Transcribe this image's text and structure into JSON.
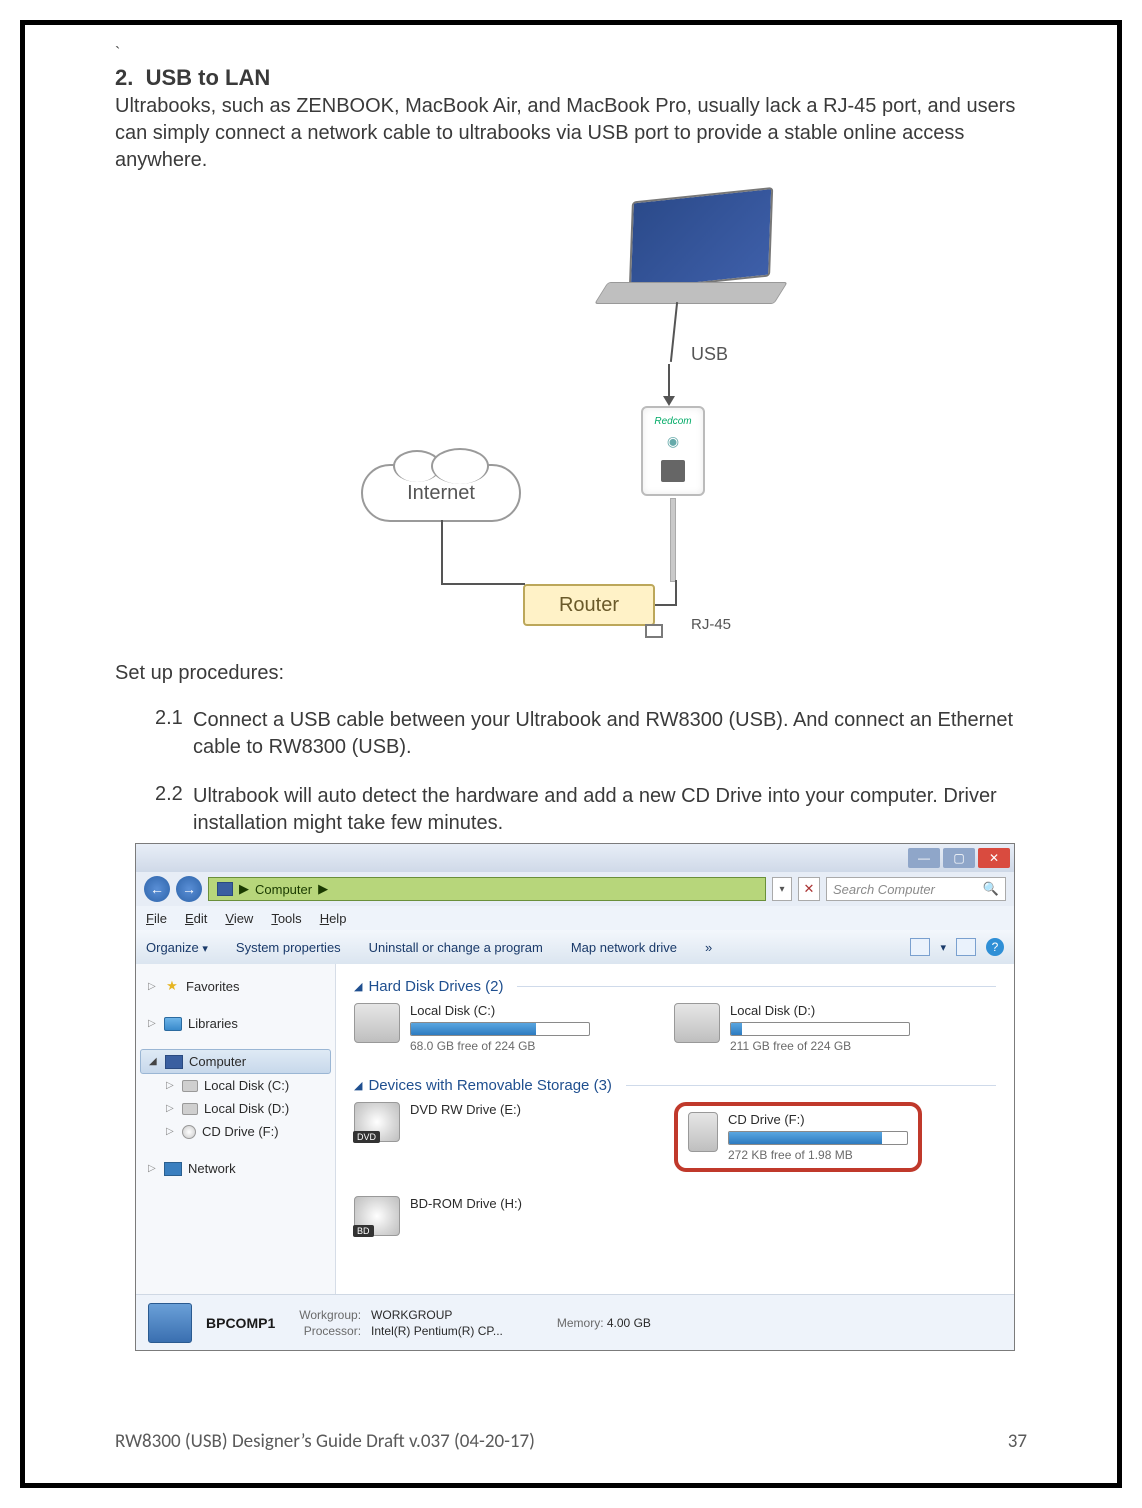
{
  "backtick": "`",
  "heading_num": "2.",
  "heading_title": "USB to LAN",
  "intro": "Ultrabooks, such as ZENBOOK, MacBook Air, and MacBook Pro, usually lack a RJ-45 port, and users can simply connect a network cable to ultrabooks via USB port to provide a stable online access anywhere.",
  "diagram": {
    "internet": "Internet",
    "router": "Router",
    "usb": "USB",
    "rj45": "RJ-45",
    "brand": "Redcom"
  },
  "setup_label": "Set up procedures:",
  "steps": [
    {
      "num": "2.1",
      "text": "Connect a USB cable between your Ultrabook and RW8300 (USB). And connect an Ethernet cable to RW8300 (USB)."
    },
    {
      "num": "2.2",
      "text": "Ultrabook will auto detect the hardware and add a new CD Drive into your computer. Driver installation might take few minutes."
    }
  ],
  "explorer": {
    "breadcrumb_label": "Computer",
    "breadcrumb_arrow": "▶",
    "search_placeholder": "Search Computer",
    "menus": {
      "file": "File",
      "edit": "Edit",
      "view": "View",
      "tools": "Tools",
      "help": "Help"
    },
    "toolbar": {
      "organize": "Organize",
      "sysprops": "System properties",
      "uninstall": "Uninstall or change a program",
      "mapdrive": "Map network drive",
      "more": "»"
    },
    "sidebar": {
      "favorites": "Favorites",
      "libraries": "Libraries",
      "computer": "Computer",
      "local_c": "Local Disk (C:)",
      "local_d": "Local Disk (D:)",
      "cd_f": "CD Drive (F:)",
      "network": "Network"
    },
    "groups": {
      "hdd": "Hard Disk Drives (2)",
      "removable": "Devices with Removable Storage (3)"
    },
    "drives": {
      "c": {
        "name": "Local Disk (C:)",
        "free": "68.0 GB free of 224 GB",
        "fill": 70
      },
      "d": {
        "name": "Local Disk (D:)",
        "free": "211 GB free of 224 GB",
        "fill": 6
      },
      "dvd": {
        "name": "DVD RW Drive (E:)",
        "badge": "DVD"
      },
      "cdf": {
        "name": "CD Drive (F:)",
        "free": "272 KB free of 1.98 MB",
        "fill": 86
      },
      "bd": {
        "name": "BD-ROM Drive (H:)",
        "badge": "BD"
      }
    },
    "status": {
      "name": "BPCOMP1",
      "workgroup_lbl": "Workgroup:",
      "workgroup_val": "WORKGROUP",
      "processor_lbl": "Processor:",
      "processor_val": "Intel(R) Pentium(R) CP...",
      "memory_lbl": "Memory:",
      "memory_val": "4.00 GB"
    }
  },
  "footer": {
    "left": "RW8300 (USB) Designer’s Guide Draft v.037 (04-20-17)",
    "right": "37"
  }
}
